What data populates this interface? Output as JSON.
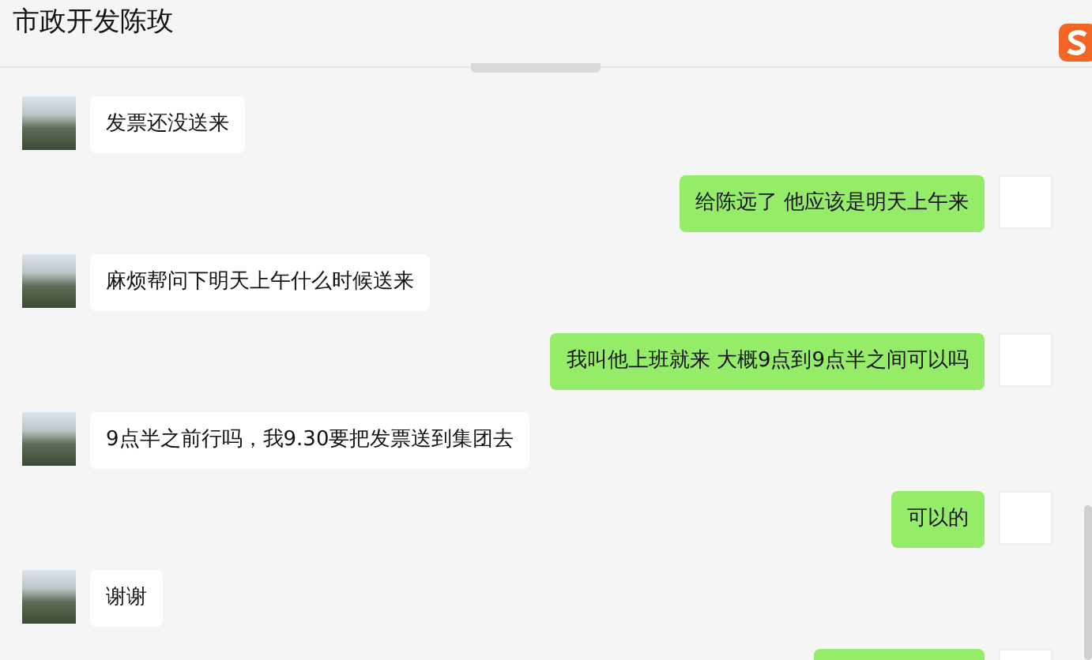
{
  "chat": {
    "title": "市政开发陈玫"
  },
  "messages": [
    {
      "kind": "received",
      "text": "发票还没送来"
    },
    {
      "kind": "sent",
      "text": "给陈远了 他应该是明天上午来"
    },
    {
      "kind": "received",
      "text": "麻烦帮问下明天上午什么时候送来"
    },
    {
      "kind": "sent",
      "text": "我叫他上班就来 大概9点到9点半之间可以吗"
    },
    {
      "kind": "received",
      "text": "9点半之前行吗，我9.30要把发票送到集团去"
    },
    {
      "kind": "sent",
      "text": "可以的"
    },
    {
      "kind": "received",
      "text": "谢谢"
    }
  ]
}
